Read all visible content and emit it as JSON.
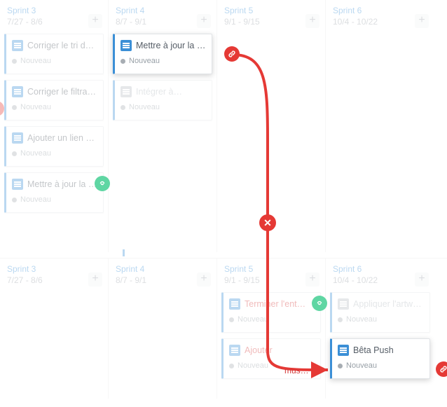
{
  "status_label": "Nouveau",
  "add_glyph": "+",
  "close_glyph": "✕",
  "arrow_label": "mus…",
  "colors": {
    "accent": "#3b8fd6",
    "danger": "#e53935",
    "success": "#5fd6a3"
  },
  "top_board": {
    "columns": [
      {
        "title": "Sprint 3",
        "dates": "7/27 - 8/6",
        "cards": [
          {
            "title": "Corriger le tri du l…"
          },
          {
            "title": "Corriger le filtrage pa…"
          },
          {
            "title": "Ajouter un lien vers l…"
          },
          {
            "title": "Mettre à jour la p…",
            "link": "green"
          }
        ]
      },
      {
        "title": "Sprint 4",
        "dates": "8/7 - 9/1",
        "cards": [
          {
            "title": "Mettre à jour la pa…",
            "highlight": true,
            "link": "red"
          },
          {
            "title": "Intégrer à…",
            "muted": true
          }
        ]
      },
      {
        "title": "Sprint 5",
        "dates": "9/1 - 9/15",
        "cards": []
      },
      {
        "title": "Sprint 6",
        "dates": "10/4 - 10/22",
        "cards": []
      }
    ]
  },
  "bottom_board": {
    "columns": [
      {
        "title": "Sprint 3",
        "dates": "7/27 - 8/6",
        "cards": []
      },
      {
        "title": "Sprint 4",
        "dates": "8/7 - 9/1",
        "cards": []
      },
      {
        "title": "Sprint 5",
        "dates": "9/1 - 9/15",
        "cards": [
          {
            "title": "Terminer l'ent…",
            "red": true,
            "link": "green"
          },
          {
            "title": "Ajouter",
            "red": true
          }
        ]
      },
      {
        "title": "Sprint 6",
        "dates": "10/4 - 10/22",
        "cards": [
          {
            "title": "Appliquer l'artwork fin…",
            "muted": true
          },
          {
            "title": "Bêta Push",
            "highlight": true,
            "link": "red"
          }
        ]
      }
    ]
  }
}
